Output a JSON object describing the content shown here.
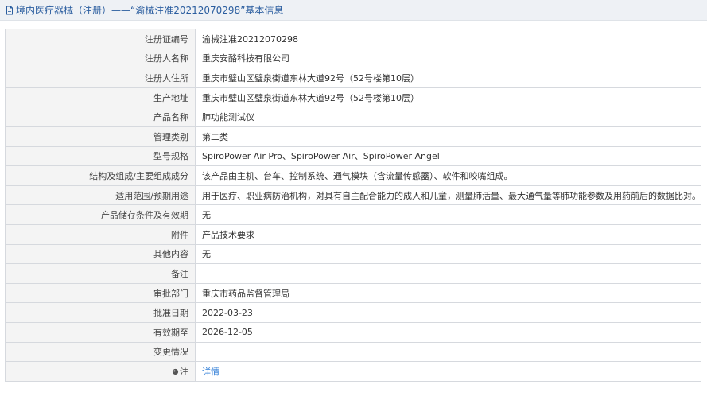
{
  "header": {
    "title": "境内医疗器械（注册）——“渝械注准20212070298”基本信息",
    "icon": "document-icon"
  },
  "rows": [
    {
      "label": "注册证编号",
      "value": "渝械注准20212070298"
    },
    {
      "label": "注册人名称",
      "value": "重庆安酪科技有限公司"
    },
    {
      "label": "注册人住所",
      "value": "重庆市璧山区璧泉街道东林大道92号（52号楼第10层）"
    },
    {
      "label": "生产地址",
      "value": "重庆市璧山区璧泉街道东林大道92号（52号楼第10层）"
    },
    {
      "label": "产品名称",
      "value": "肺功能测试仪"
    },
    {
      "label": "管理类别",
      "value": "第二类"
    },
    {
      "label": "型号规格",
      "value": "SpiroPower Air Pro、SpiroPower Air、SpiroPower Angel"
    },
    {
      "label": "结构及组成/主要组成成分",
      "value": "该产品由主机、台车、控制系统、通气模块（含流量传感器）、软件和咬嘴组成。"
    },
    {
      "label": "适用范围/预期用途",
      "value": "用于医疗、职业病防治机构，对具有自主配合能力的成人和儿童，测量肺活量、最大通气量等肺功能参数及用药前后的数据比对。"
    },
    {
      "label": "产品储存条件及有效期",
      "value": "无"
    },
    {
      "label": "附件",
      "value": "产品技术要求"
    },
    {
      "label": "其他内容",
      "value": "无"
    },
    {
      "label": "备注",
      "value": ""
    },
    {
      "label": "审批部门",
      "value": "重庆市药品监督管理局"
    },
    {
      "label": "批准日期",
      "value": "2022-03-23"
    },
    {
      "label": "有效期至",
      "value": "2026-12-05"
    },
    {
      "label": "变更情况",
      "value": ""
    }
  ],
  "note": {
    "label": "注",
    "icon": "pin-icon",
    "link_text": "详情"
  },
  "colors": {
    "header_bg": "#eef1f5",
    "header_text": "#2a5d9f",
    "label_bg": "#f4f4f4",
    "border": "#d6d9de",
    "link": "#2a7ad6"
  }
}
